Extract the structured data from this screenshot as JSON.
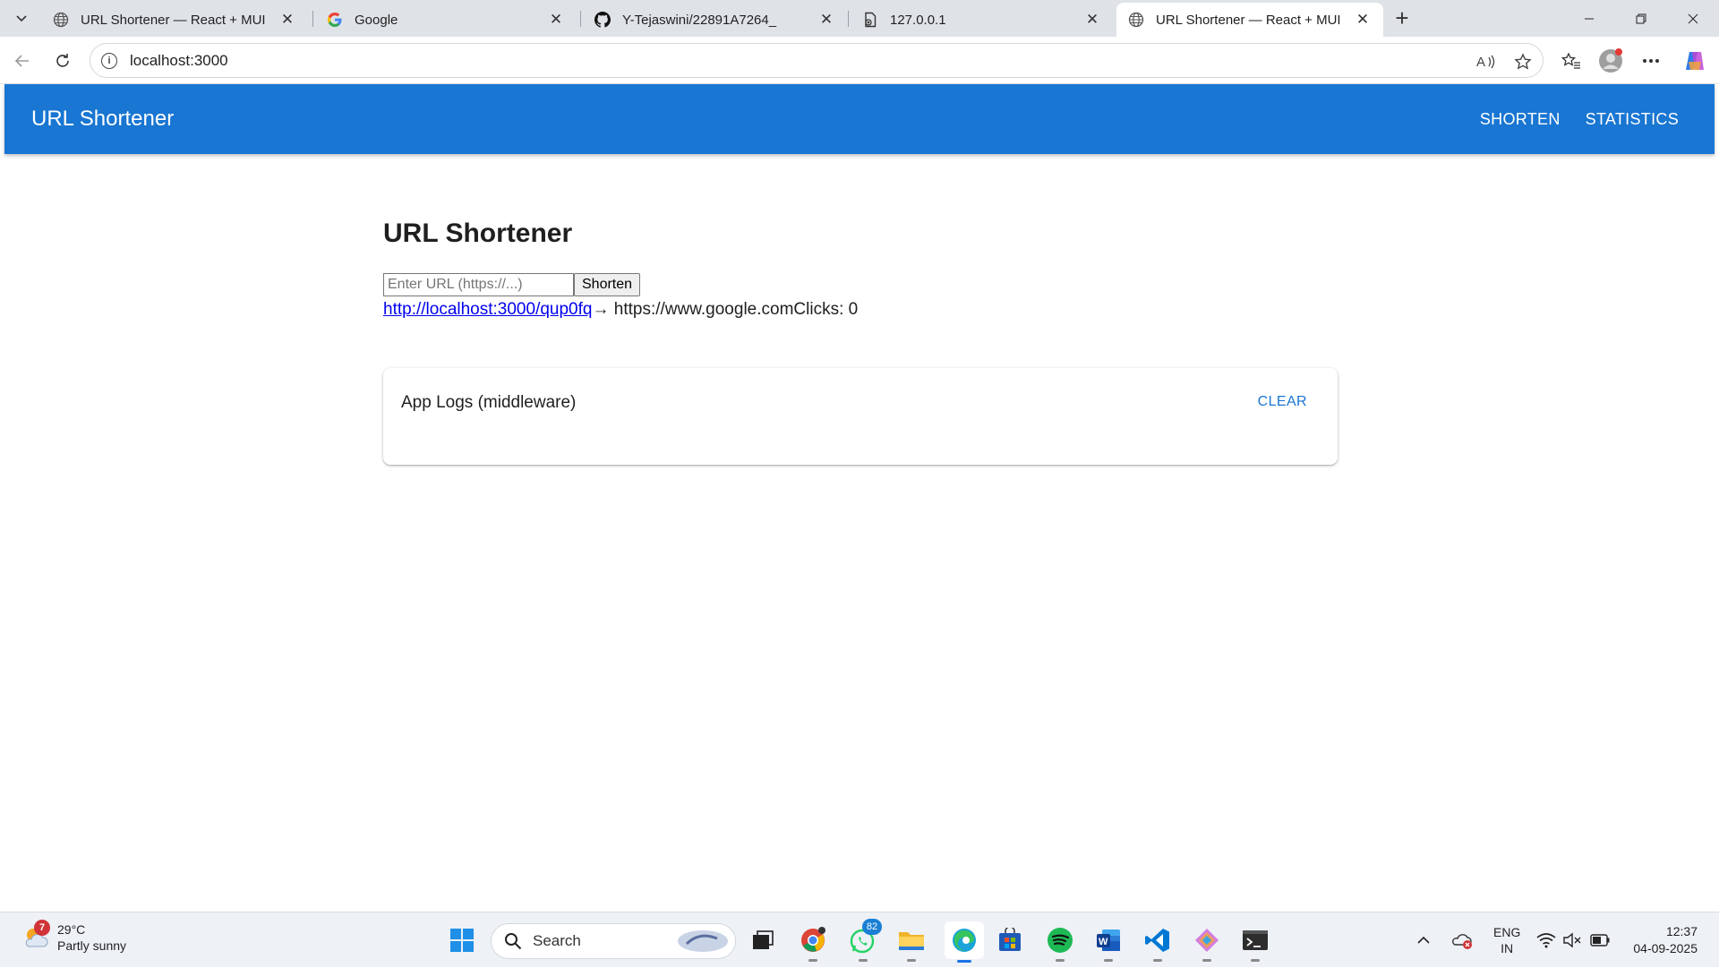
{
  "browser": {
    "tabs": [
      {
        "title": "URL Shortener — React + MUI",
        "icon": "globe-icon",
        "active": false
      },
      {
        "title": "Google",
        "icon": "google-icon",
        "active": false
      },
      {
        "title": "Y-Tejaswini/22891A7264_",
        "icon": "github-icon",
        "active": false
      },
      {
        "title": "127.0.0.1",
        "icon": "file-icon",
        "active": false
      },
      {
        "title": "URL Shortener — React + MUI",
        "icon": "globe-icon",
        "active": true
      }
    ],
    "address": "localhost:3000"
  },
  "app": {
    "brand": "URL Shortener",
    "nav": {
      "shorten": "SHORTEN",
      "statistics": "STATISTICS"
    },
    "heading": "URL Shortener",
    "form": {
      "placeholder": "Enter URL (https://...)",
      "value": "",
      "button": "Shorten"
    },
    "result": {
      "short_url": "http://localhost:3000/qup0fq",
      "arrow": "→ ",
      "original": "https://www.google.com",
      "clicks_label": "Clicks: ",
      "clicks": "0"
    },
    "logs": {
      "title": "App Logs (middleware)",
      "clear": "CLEAR"
    },
    "colors": {
      "primary": "#1976d2"
    }
  },
  "taskbar": {
    "weather": {
      "temp": "29°C",
      "desc": "Partly sunny",
      "badge": "7"
    },
    "search_label": "Search",
    "whatsapp_badge": "82",
    "lang": {
      "line1": "ENG",
      "line2": "IN"
    },
    "clock": {
      "time": "12:37",
      "date": "04-09-2025"
    }
  }
}
